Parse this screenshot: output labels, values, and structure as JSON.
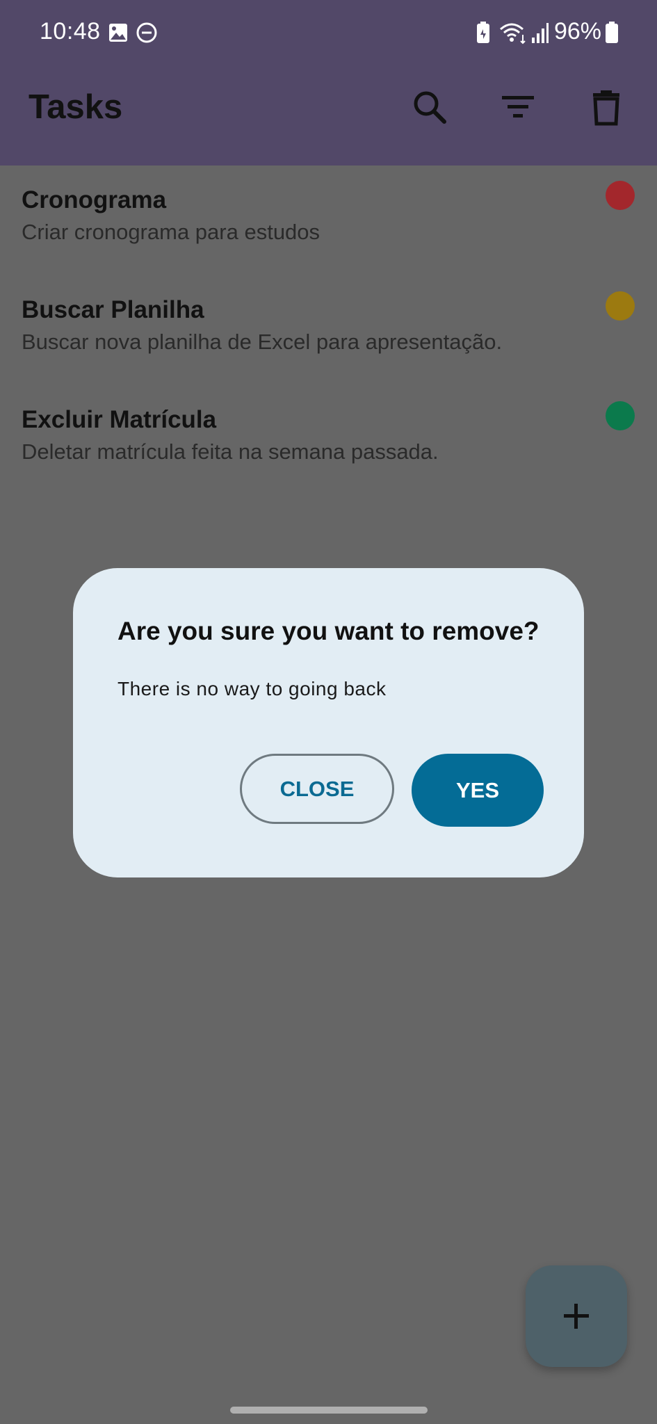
{
  "status_bar": {
    "time": "10:48",
    "battery": "96%",
    "icons": [
      "image-icon",
      "do-not-disturb-icon",
      "battery-saver-icon",
      "wifi-icon",
      "signal-icon",
      "battery-icon"
    ]
  },
  "app_bar": {
    "title": "Tasks",
    "actions": [
      "search-icon",
      "filter-icon",
      "delete-icon"
    ]
  },
  "tasks": [
    {
      "title": "Cronograma",
      "description": "Criar cronograma para estudos",
      "priority_color": "#a3272c"
    },
    {
      "title": "Buscar Planilha",
      "description": "Buscar nova planilha de Excel para apresentação.",
      "priority_color": "#9c7a10"
    },
    {
      "title": "Excluir Matrícula",
      "description": "Deletar matrícula feita na semana passada.",
      "priority_color": "#0b7a4c"
    }
  ],
  "dialog": {
    "title": "Are you sure you want to remove?",
    "message": "There is no way to going back",
    "close_label": "CLOSE",
    "yes_label": "YES"
  },
  "fab": {
    "icon": "plus-icon"
  },
  "colors": {
    "app_bar": "#524868",
    "dialog_bg": "#e2edf4",
    "accent": "#046c96",
    "scrim": "#666666"
  }
}
